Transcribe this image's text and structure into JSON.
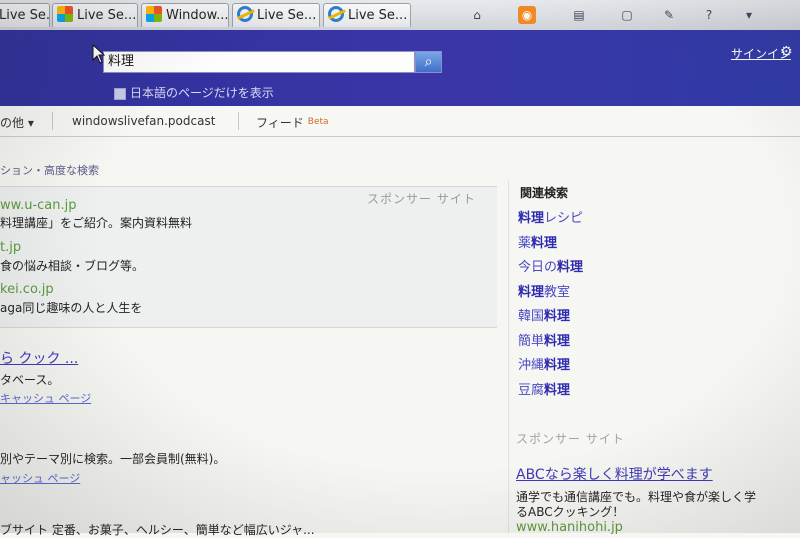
{
  "browser": {
    "tabs": [
      {
        "label": "Live Se..."
      },
      {
        "label": "Live Se..."
      },
      {
        "label": "Window..."
      },
      {
        "label": "Live Se..."
      },
      {
        "label": "Live Se..."
      }
    ]
  },
  "header": {
    "search_value": "料理",
    "lang_only_label": "日本語のページだけを表示",
    "signin_label": "サインイン"
  },
  "subnav": {
    "more_label": "の他 ▾",
    "item1": "windowslivefan.podcast",
    "item2": "フィード",
    "beta": "Beta"
  },
  "options": {
    "item1": "ション",
    "sep": "・",
    "item2": "高度な検索"
  },
  "sponsored": {
    "title": "スポンサー サイト",
    "ads": [
      {
        "url": "ww.u-can.jp",
        "desc": "料理講座」をご紹介。案内資料無料"
      },
      {
        "url": "t.jp",
        "desc": "食の悩み相談・ブログ等。"
      },
      {
        "url": "kei.co.jp",
        "desc": "aga同じ趣味の人と人生を"
      }
    ]
  },
  "results": [
    {
      "title": "ら クック ...",
      "desc": "タベース。",
      "meta": "キャッシュ ページ"
    },
    {
      "desc": "別やテーマ別に検索。一部会員制(無料)。",
      "meta": "ャッシュ ページ"
    },
    {
      "desc": "ブサイト 定番、お菓子、ヘルシー、簡単など幅広いジャ..."
    }
  ],
  "related": {
    "title": "関連検索",
    "items": [
      {
        "pre": "",
        "bold": "料理",
        "post": "レシピ"
      },
      {
        "pre": "薬",
        "bold": "料理",
        "post": ""
      },
      {
        "pre": "今日の",
        "bold": "料理",
        "post": ""
      },
      {
        "pre": "",
        "bold": "料理",
        "post": "教室"
      },
      {
        "pre": "韓国",
        "bold": "料理",
        "post": ""
      },
      {
        "pre": "簡単",
        "bold": "料理",
        "post": ""
      },
      {
        "pre": "沖縄",
        "bold": "料理",
        "post": ""
      },
      {
        "pre": "豆腐",
        "bold": "料理",
        "post": ""
      }
    ]
  },
  "right_sponsored": {
    "title": "スポンサー サイト",
    "ad_title": "ABCなら楽しく料理が学べます",
    "ad_desc1": "通学でも通信講座でも。料理や食が楽しく学",
    "ad_desc2": "るABCクッキング！",
    "ad_url": "www.hanihohi.jp"
  },
  "colors": {
    "header_blue": "#3b36a8",
    "link_blue": "#3b38b8",
    "ad_green": "#5c9a39"
  }
}
